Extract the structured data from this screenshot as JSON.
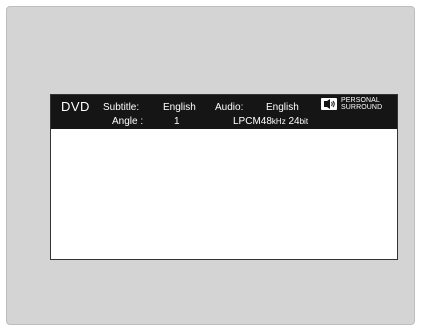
{
  "osd": {
    "disc_type": "DVD",
    "subtitle_label": "Subtitle:",
    "subtitle_value": "English",
    "audio_label": "Audio:",
    "audio_value": "English",
    "angle_label": "Angle :",
    "angle_value": "1",
    "audio_format": {
      "codec": "LPCM",
      "sample_rate_num": "48",
      "sample_rate_unit": "kHz",
      "bit_depth_num": "24",
      "bit_depth_unit": "bit"
    },
    "logo": {
      "icon": "personal-surround-icon",
      "line1": "PERSONAL",
      "line2": "SURROUND"
    }
  },
  "colors": {
    "osd_background": "#151515",
    "osd_text": "#ffffff",
    "frame_background": "#d4d4d4",
    "screen_background": "#ffffff"
  }
}
